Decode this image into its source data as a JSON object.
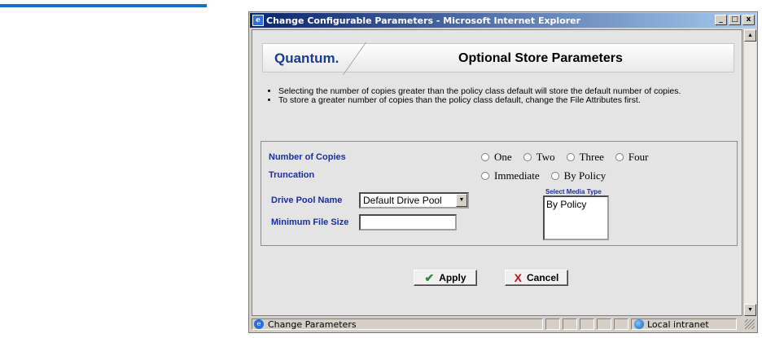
{
  "window": {
    "title": "Change Configurable Parameters - Microsoft Internet Explorer",
    "minimize": "_",
    "maximize": "□",
    "close": "x"
  },
  "header": {
    "logo": "Quantum.",
    "title": "Optional Store Parameters"
  },
  "notes": [
    "Selecting the number of copies greater than the policy class default will store the default number of copies.",
    "To store a greater number of copies than the policy class default, change the File Attributes first."
  ],
  "form": {
    "copies_label": "Number of Copies",
    "copies_options": [
      "One",
      "Two",
      "Three",
      "Four"
    ],
    "truncation_label": "Truncation",
    "truncation_options": [
      "Immediate",
      "By Policy"
    ],
    "drive_pool_label": "Drive Pool Name",
    "drive_pool_value": "Default Drive Pool",
    "min_file_size_label": "Minimum File Size",
    "min_file_size_value": "",
    "media_type_label": "Select Media Type",
    "media_type_options": [
      "By Policy"
    ]
  },
  "buttons": {
    "apply": "Apply",
    "cancel": "Cancel"
  },
  "status": {
    "text": "Change Parameters",
    "zone": "Local intranet"
  }
}
